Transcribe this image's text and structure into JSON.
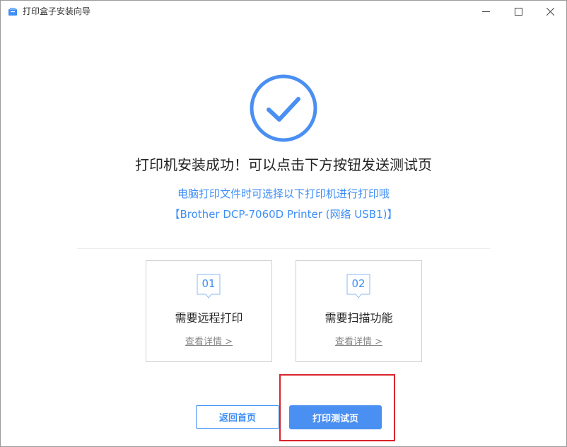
{
  "window": {
    "title": "打印盒子安装向导",
    "app_icon": "printer-box-icon",
    "controls": [
      "minimize-icon",
      "maximize-icon",
      "close-icon"
    ]
  },
  "main": {
    "status_icon": "checkmark-circle-icon",
    "headline": "打印机安装成功！可以点击下方按钮发送测试页",
    "subline": "电脑打印文件时可选择以下打印机进行打印哦",
    "printer_name": "【Brother DCP-7060D Printer (网络 USB1)】"
  },
  "cards": [
    {
      "number": "01",
      "title": "需要远程打印",
      "link": "查看详情 >"
    },
    {
      "number": "02",
      "title": "需要扫描功能",
      "link": "查看详情 >"
    }
  ],
  "buttons": {
    "back": "返回首页",
    "test_page": "打印测试页"
  },
  "colors": {
    "accent": "#3e8ef7",
    "primary_button": "#4a8ff2",
    "highlight": "#d9232b"
  }
}
